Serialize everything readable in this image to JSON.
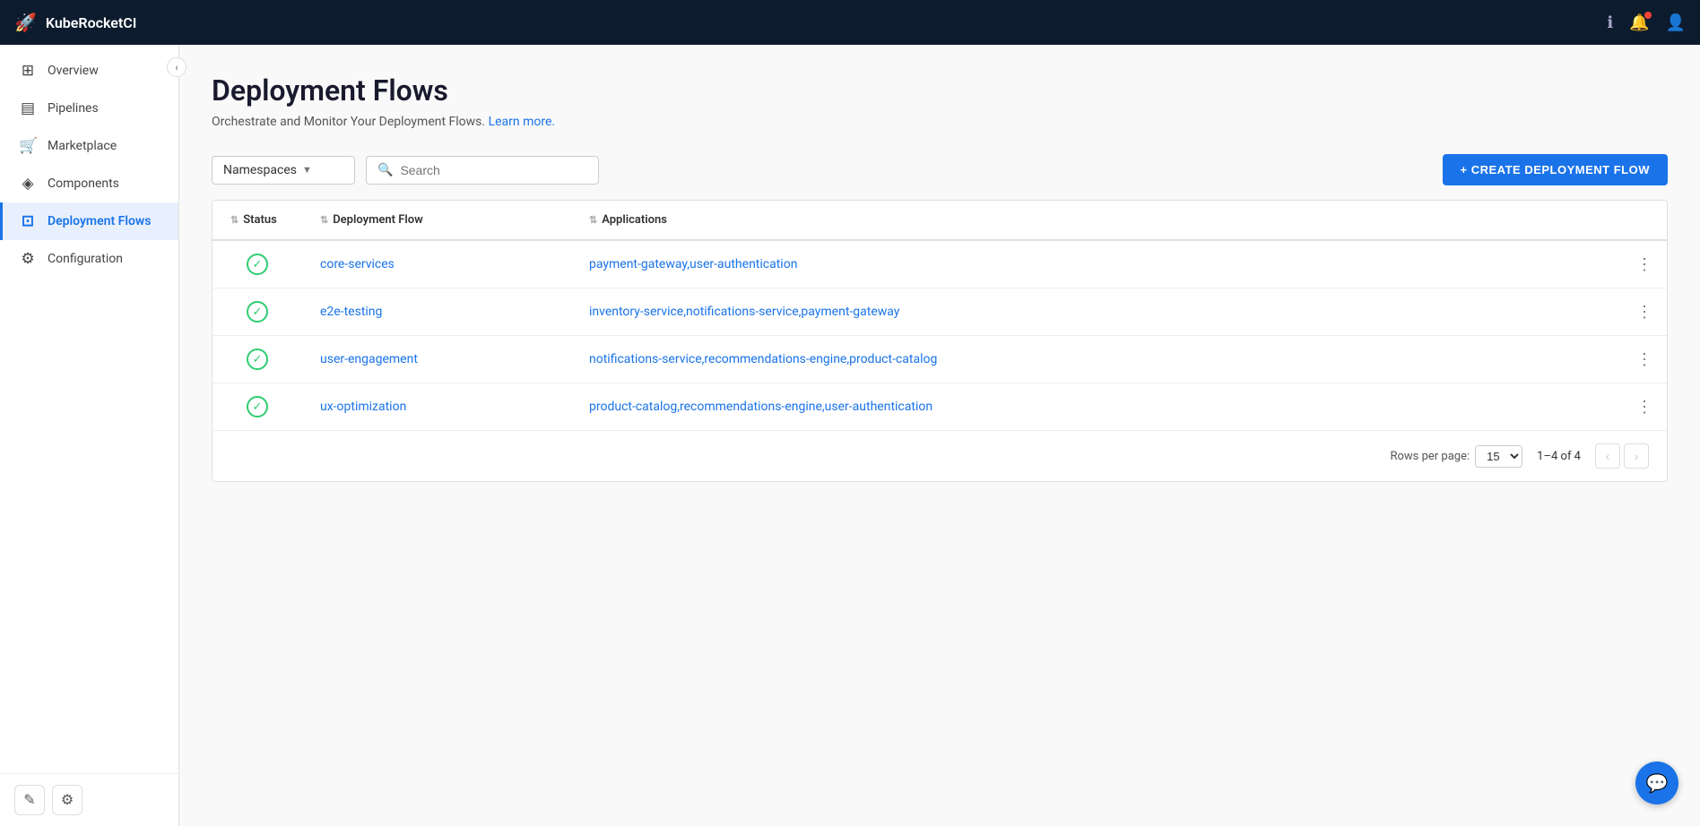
{
  "app": {
    "name": "KubeRocketCI",
    "logo_icon": "🚀"
  },
  "topbar": {
    "info_icon": "ℹ",
    "bell_icon": "🔔",
    "has_notification": true,
    "avatar_icon": "👤"
  },
  "sidebar": {
    "collapse_icon": "‹",
    "items": [
      {
        "id": "overview",
        "label": "Overview",
        "icon": "⊞",
        "active": false
      },
      {
        "id": "pipelines",
        "label": "Pipelines",
        "icon": "▤",
        "active": false
      },
      {
        "id": "marketplace",
        "label": "Marketplace",
        "icon": "🛒",
        "active": false
      },
      {
        "id": "components",
        "label": "Components",
        "icon": "◈",
        "active": false
      },
      {
        "id": "deployment-flows",
        "label": "Deployment Flows",
        "icon": "⊡",
        "active": true
      },
      {
        "id": "configuration",
        "label": "Configuration",
        "icon": "⚙",
        "active": false
      }
    ],
    "bottom_edit_icon": "✎",
    "bottom_settings_icon": "⚙"
  },
  "page": {
    "title": "Deployment Flows",
    "subtitle": "Orchestrate and Monitor Your Deployment Flows.",
    "learn_more_label": "Learn more."
  },
  "toolbar": {
    "namespace_placeholder": "Namespaces",
    "search_placeholder": "Search",
    "create_button_label": "+ CREATE DEPLOYMENT FLOW"
  },
  "table": {
    "columns": [
      {
        "id": "status",
        "label": "Status"
      },
      {
        "id": "deployment-flow",
        "label": "Deployment Flow"
      },
      {
        "id": "applications",
        "label": "Applications"
      }
    ],
    "rows": [
      {
        "id": 1,
        "status": "ok",
        "flow_name": "core-services",
        "applications": "payment-gateway,user-authentication"
      },
      {
        "id": 2,
        "status": "ok",
        "flow_name": "e2e-testing",
        "applications": "inventory-service,notifications-service,payment-gateway"
      },
      {
        "id": 3,
        "status": "ok",
        "flow_name": "user-engagement",
        "applications": "notifications-service,recommendations-engine,product-catalog"
      },
      {
        "id": 4,
        "status": "ok",
        "flow_name": "ux-optimization",
        "applications": "product-catalog,recommendations-engine,user-authentication"
      }
    ]
  },
  "pagination": {
    "rows_per_page_label": "Rows per page:",
    "rows_per_page_value": "15",
    "range_label": "1–4 of 4",
    "prev_icon": "‹",
    "next_icon": "›"
  },
  "chat_fab_icon": "💬"
}
